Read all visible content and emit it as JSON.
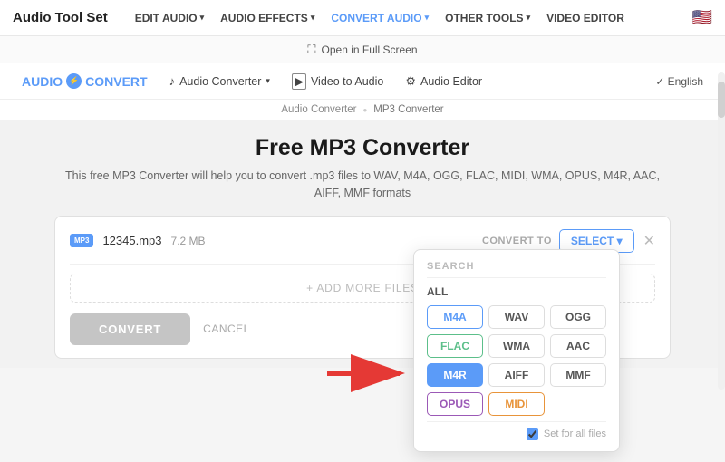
{
  "brand": {
    "name": "Audio Tool Set",
    "icon_label": "🎵"
  },
  "nav": {
    "items": [
      {
        "label": "EDIT AUDIO",
        "has_dropdown": true,
        "active": false
      },
      {
        "label": "AUDIO EFFECTS",
        "has_dropdown": true,
        "active": false
      },
      {
        "label": "CONVERT AUDIO",
        "has_dropdown": true,
        "active": true
      },
      {
        "label": "OTHER TOOLS",
        "has_dropdown": true,
        "active": false
      },
      {
        "label": "VIDEO EDITOR",
        "has_dropdown": false,
        "active": false
      }
    ],
    "flag": "🇺🇸"
  },
  "fullscreen_bar": {
    "label": "Open in Full Screen"
  },
  "sub_nav": {
    "brand": "AUDIOCONVERT",
    "items": [
      {
        "label": "Audio Converter",
        "icon": "♪",
        "has_dropdown": true
      },
      {
        "label": "Video to Audio",
        "icon": "▶"
      },
      {
        "label": "Audio Editor",
        "icon": "⚙"
      }
    ],
    "language": "English"
  },
  "breadcrumb": {
    "items": [
      {
        "label": "Audio Converter"
      },
      {
        "label": "MP3 Converter",
        "current": true
      }
    ]
  },
  "page": {
    "title": "Free MP3 Converter",
    "description": "This free MP3 Converter will help you to convert .mp3 files to WAV, M4A, OGG, FLAC, MIDI, WMA, OPUS, M4R, AAC, AIFF, MMF formats"
  },
  "file": {
    "extension": "MP3",
    "name": "12345.mp3",
    "size": "7.2 MB",
    "convert_to_label": "CONVERT TO",
    "select_label": "SELECT ▾"
  },
  "add_more": {
    "label": "+ ADD MORE FILES"
  },
  "dropdown": {
    "search_label": "SEARCH",
    "all_label": "ALL",
    "formats": [
      {
        "label": "M4A",
        "style": "blue"
      },
      {
        "label": "WAV",
        "style": "normal"
      },
      {
        "label": "OGG",
        "style": "normal"
      },
      {
        "label": "FLAC",
        "style": "green"
      },
      {
        "label": "WMA",
        "style": "normal"
      },
      {
        "label": "AAC",
        "style": "normal"
      },
      {
        "label": "M4R",
        "style": "selected"
      },
      {
        "label": "AIFF",
        "style": "normal"
      },
      {
        "label": "MMF",
        "style": "normal"
      },
      {
        "label": "OPUS",
        "style": "purple"
      },
      {
        "label": "MIDI",
        "style": "orange"
      }
    ],
    "set_all_label": "Set for all files"
  },
  "convert_btn": "CONVERT",
  "cancel_link": "CANCEL"
}
